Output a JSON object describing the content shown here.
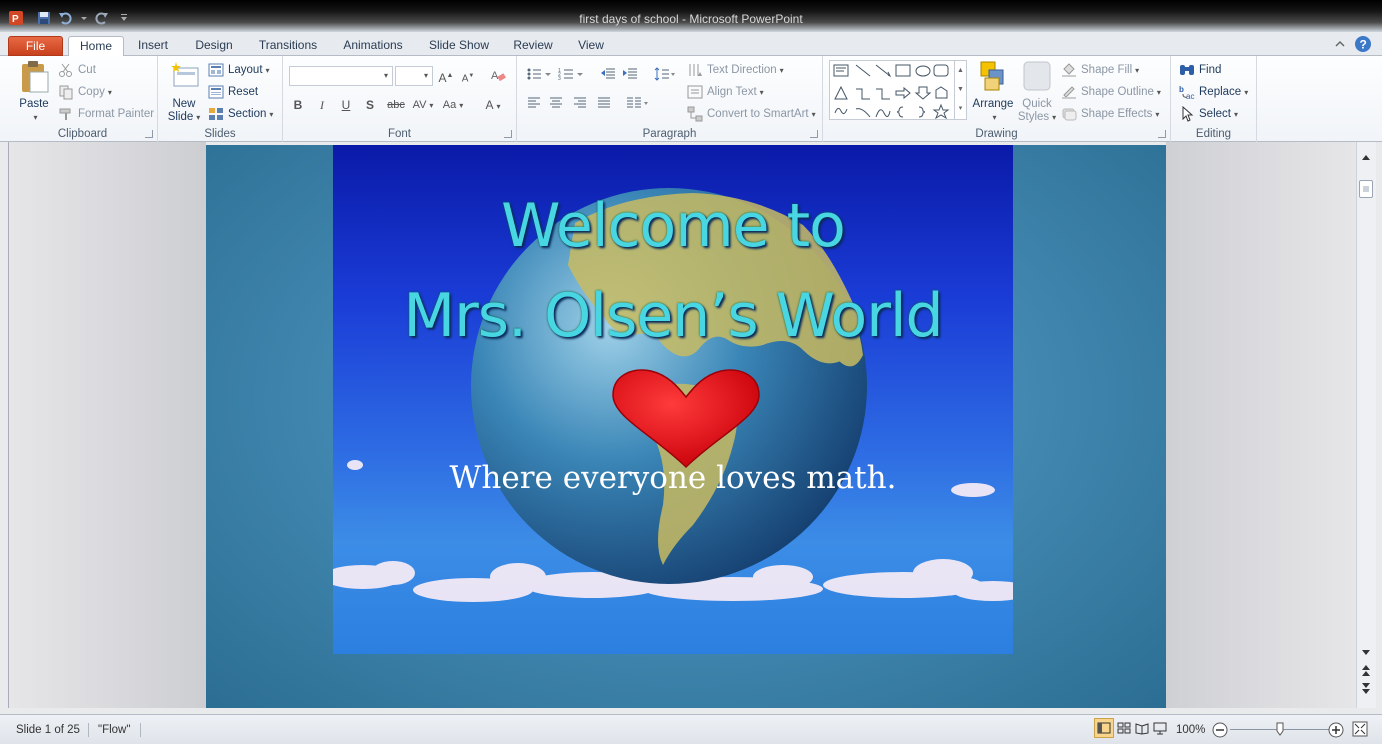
{
  "window": {
    "title": "first days of school  -  Microsoft PowerPoint"
  },
  "tabs": [
    "File",
    "Home",
    "Insert",
    "Design",
    "Transitions",
    "Animations",
    "Slide Show",
    "Review",
    "View"
  ],
  "clipboard": {
    "label": "Clipboard",
    "paste": "Paste",
    "cut": "Cut",
    "copy": "Copy",
    "format_painter": "Format Painter"
  },
  "slides_group": {
    "label": "Slides",
    "new_slide_1": "New",
    "new_slide_2": "Slide",
    "layout": "Layout",
    "reset": "Reset",
    "section": "Section"
  },
  "font": {
    "label": "Font",
    "font_name": "",
    "font_size": ""
  },
  "paragraph": {
    "label": "Paragraph",
    "text_direction": "Text Direction",
    "align_text": "Align Text",
    "convert_smartart": "Convert to SmartArt"
  },
  "drawing": {
    "label": "Drawing",
    "arrange": "Arrange",
    "quick_styles_1": "Quick",
    "quick_styles_2": "Styles",
    "shape_fill": "Shape Fill",
    "shape_outline": "Shape Outline",
    "shape_effects": "Shape Effects"
  },
  "editing": {
    "label": "Editing",
    "find": "Find",
    "replace": "Replace",
    "select": "Select"
  },
  "slide": {
    "title_line1": "Welcome to",
    "title_line2": "Mrs. Olsen’s World",
    "subtitle": "Where everyone loves math."
  },
  "status": {
    "slide_info": "Slide 1 of 25",
    "theme": "\"Flow\"",
    "zoom": "100%",
    "zoom_fraction": 0.5
  },
  "colors": {
    "file_tab": "#d24726",
    "title_text": "#49d6e3",
    "heart": "#e8101a"
  }
}
